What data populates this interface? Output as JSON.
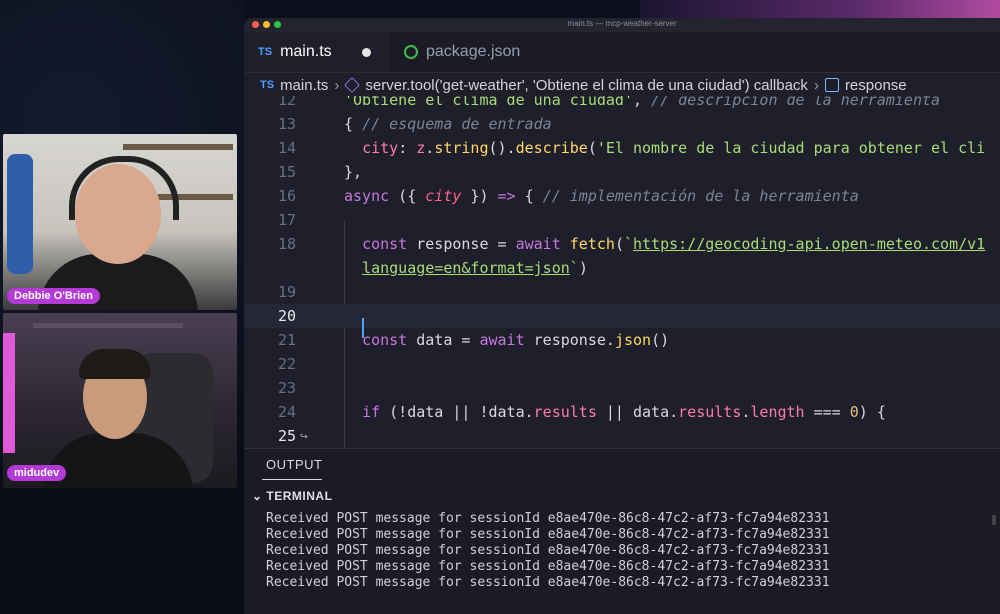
{
  "window": {
    "title": "main.ts — mcp-weather-server"
  },
  "tabs": [
    {
      "badge": "TS",
      "label": "main.ts"
    },
    {
      "label": "package.json"
    }
  ],
  "breadcrumb": {
    "badge": "TS",
    "file": "main.ts",
    "callback": "server.tool('get-weather', 'Obtiene el clima de una ciudad') callback",
    "symbol": "response"
  },
  "code": {
    "lines": [
      {
        "n": "12",
        "html": "<span class='str'>'Obtiene el clima de una ciudad'</span>, <span class='cmt'>// descripción de la herramienta</span>"
      },
      {
        "n": "13",
        "html": "{ <span class='cmt'>// esquema de entrada</span>"
      },
      {
        "n": "14",
        "html": "  <span class='prop'>city</span>: <span class='prop'>z</span>.<span class='fn'>string</span>().<span class='fn'>describe</span>(<span class='str'>'El nombre de la ciudad para obtener el cli</span>"
      },
      {
        "n": "15",
        "html": "},"
      },
      {
        "n": "16",
        "html": "<span class='kw'>async</span> ({ <span class='var'>city</span> }) <span class='kw'>=&gt;</span> { <span class='cmt'>// implementación de la herramienta</span>"
      },
      {
        "n": "17",
        "html": ""
      },
      {
        "n": "18",
        "html": "  <span class='kw'>const</span> response = <span class='kw'>await</span> <span class='fn'>fetch</span>(<span class='str'>`<u>https://geocoding-api.open-meteo.com/v1</u></span>"
      },
      {
        "n": "",
        "html": "  <span class='str'><u>language=en&amp;format=json</u>`</span>)"
      },
      {
        "n": "19",
        "html": ""
      },
      {
        "n": "20",
        "html": ""
      },
      {
        "n": "21",
        "html": "  <span class='kw'>const</span> data = <span class='kw'>await</span> response.<span class='fn'>json</span>()"
      },
      {
        "n": "22",
        "html": ""
      },
      {
        "n": "23",
        "html": ""
      },
      {
        "n": "24",
        "html": "  <span class='kw'>if</span> (!data || !data.<span class='prop'>results</span> || data.<span class='prop'>results</span>.<span class='prop'>length</span> === <span class='num'>0</span>) {"
      },
      {
        "n": "25",
        "html": ""
      }
    ]
  },
  "panel": {
    "output_tab": "OUTPUT",
    "terminal_header": "TERMINAL",
    "terminal_lines": [
      "Received POST message for sessionId e8ae470e-86c8-47c2-af73-fc7a94e82331",
      "Received POST message for sessionId e8ae470e-86c8-47c2-af73-fc7a94e82331",
      "Received POST message for sessionId e8ae470e-86c8-47c2-af73-fc7a94e82331",
      "Received POST message for sessionId e8ae470e-86c8-47c2-af73-fc7a94e82331",
      "Received POST message for sessionId e8ae470e-86c8-47c2-af73-fc7a94e82331"
    ]
  },
  "participants": [
    {
      "name": "Debbie O'Brien"
    },
    {
      "name": "midudev"
    }
  ],
  "colors": {
    "accent": "#4ea3ff",
    "name_tag": "#b43ad8",
    "editor_bg": "#1e1f2b"
  }
}
